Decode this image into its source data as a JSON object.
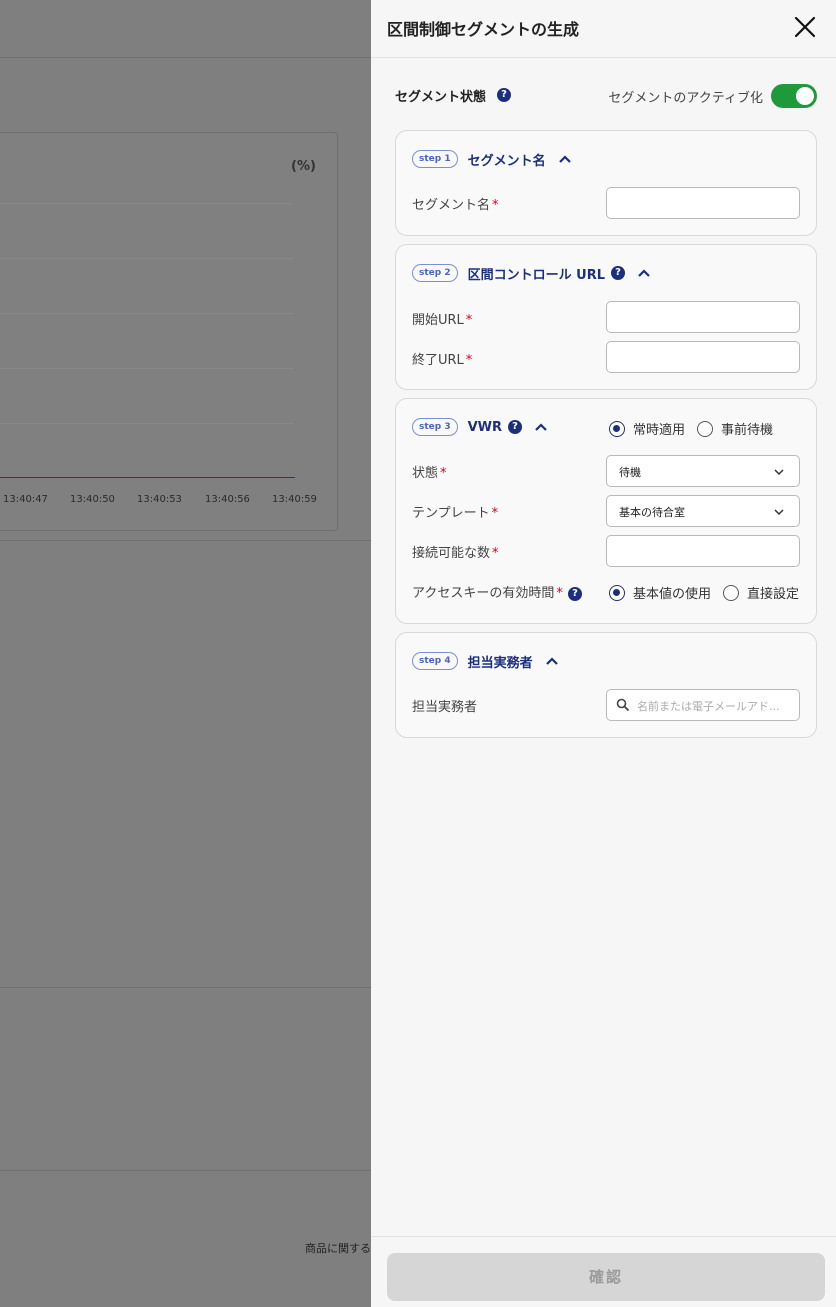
{
  "background": {
    "chart_unit": "(%)",
    "x_ticks": [
      "13:40:47",
      "13:40:50",
      "13:40:53",
      "13:40:56",
      "13:40:59"
    ],
    "footer_text": "商品に関する"
  },
  "panel": {
    "title": "区間制御セグメントの生成",
    "segment_state": {
      "label": "セグメント状態",
      "help": "?",
      "toggle_label": "セグメントのアクティブ化",
      "active": true
    },
    "step1": {
      "badge": "step 1",
      "title": "セグメント名",
      "field_label": "セグメント名",
      "required": "*",
      "value": ""
    },
    "step2": {
      "badge": "step 2",
      "title": "区間コントロール URL",
      "help": "?",
      "start_label": "開始URL",
      "end_label": "終了URL",
      "required": "*",
      "start_value": "",
      "end_value": ""
    },
    "step3": {
      "badge": "step 3",
      "title": "VWR",
      "help": "?",
      "mode_options": [
        "常時適用",
        "事前待機"
      ],
      "mode_selected": "常時適用",
      "state_label": "状態",
      "state_value": "待機",
      "template_label": "テンプレート",
      "template_value": "基本の待合室",
      "capacity_label": "接続可能な数",
      "capacity_value": "",
      "access_label": "アクセスキーの有効時間",
      "access_options": [
        "基本値の使用",
        "直接設定"
      ],
      "access_selected": "基本値の使用",
      "required": "*"
    },
    "step4": {
      "badge": "step 4",
      "title": "担当実務者",
      "field_label": "担当実務者",
      "search_placeholder": "名前または電子メールアド..."
    },
    "confirm_label": "確認"
  },
  "colors": {
    "accent": "#1b2f7d",
    "toggle_on": "#1f9a3a",
    "required": "#d0021b",
    "overlay": "#7f7f7f"
  }
}
